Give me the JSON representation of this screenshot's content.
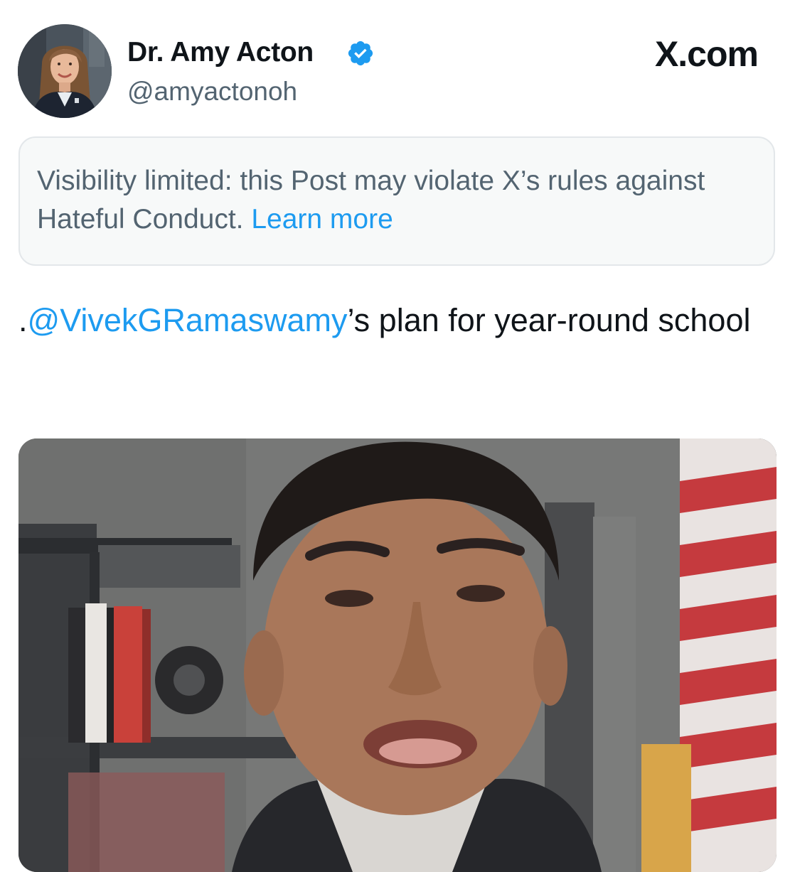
{
  "author": {
    "display_name": "Dr. Amy Acton",
    "handle": "@amyactonoh",
    "verified": true,
    "avatar_icon": "profile-photo"
  },
  "brand": {
    "label": "X.com"
  },
  "notice": {
    "text": "Visibility limited: this Post may violate X’s rules against Hateful Conduct.",
    "link_label": "Learn more",
    "link_color": "#1d9bf0"
  },
  "post": {
    "prefix": ".",
    "mention": "@VivekGRamaswamy",
    "text_after_mention": "’s plan for year-round school"
  },
  "media": {
    "kind": "video-thumbnail",
    "icon": "video-frame"
  },
  "colors": {
    "accent": "#1d9bf0",
    "text_primary": "#0f1419",
    "text_secondary": "#536471",
    "notice_bg": "#f7f9f9",
    "notice_border": "#e3e7ea"
  }
}
